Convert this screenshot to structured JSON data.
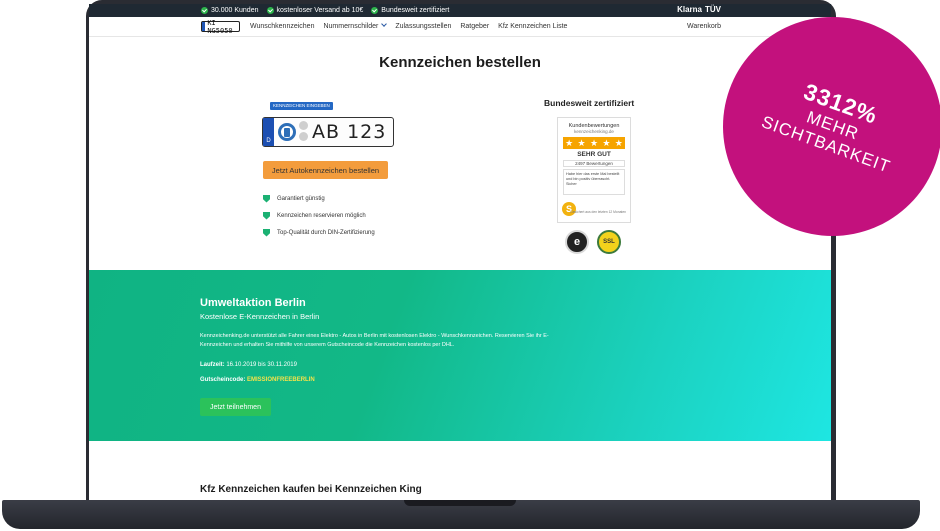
{
  "topbar": {
    "usps": [
      "30.000 Kunden",
      "kostenloser Versand ab 10€",
      "Bundesweit zertifiziert"
    ],
    "partners": [
      "Klarna",
      "TÜV"
    ]
  },
  "nav": {
    "logo_text": "KI NG5050",
    "links": [
      "Wunschkennzeichen",
      "Nummernschilder",
      "Zulassungsstellen",
      "Ratgeber",
      "Kfz Kennzeichen Liste"
    ],
    "cart": "Warenkorb"
  },
  "hero": {
    "title": "Kennzeichen bestellen",
    "badge": "KENNZEICHEN EINGEBEN",
    "plate_country": "D",
    "plate_text": "AB 123",
    "order_button": "Jetzt Autokennzeichen bestellen",
    "benefits": [
      "Garantiert günstig",
      "Kennzeichen reservieren möglich",
      "Top-Qualität durch DIN-Zertifizierung"
    ]
  },
  "certification": {
    "title": "Bundesweit zertifiziert",
    "card_title": "Kundenbewertungen",
    "card_domain": "kennzeichenking.de",
    "grade": "SEHR GUT",
    "reviews": "2497 Bewertungen",
    "quote": "Habe hier das erste Mal bestellt und bin positiv überrascht. Sicher",
    "footer": "Gesichert aus den letzten 12 Monaten",
    "trust_badge": "e",
    "ssl_badge": "SSL"
  },
  "campaign": {
    "title": "Umweltaktion Berlin",
    "subtitle": "Kostenlose E-Kennzeichen in Berlin",
    "text": "Kennzeichenking.de unterstützt alle Fahrer eines Elektro - Autos in Berlin mit kostenlosen Elektro - Wunschkennzeichen. Reservieren Sie ihr E-Kennzeichen und erhalten Sie mithilfe von unserem Gutscheincode die Kennzeichen kostenlos per DHL.",
    "runtime_label": "Laufzeit:",
    "runtime_value": "16.10.2019 bis 30.11.2019",
    "code_label": "Gutscheincode:",
    "code_value": "EMISSIONFREEBERLIN",
    "button": "Jetzt teilnehmen"
  },
  "bottom_heading": "Kfz Kennzeichen kaufen bei Kennzeichen King",
  "sticker": {
    "value": "3312%",
    "line1": "MEHR",
    "line2": "SICHTBARKEIT",
    "color": "#c3117d"
  }
}
